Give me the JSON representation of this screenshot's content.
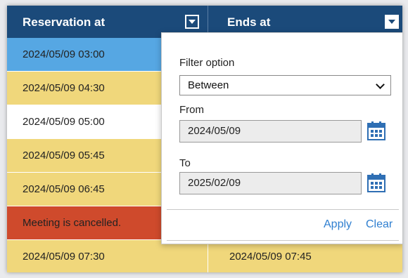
{
  "header": {
    "col1": "Reservation at",
    "col2": "Ends at"
  },
  "rows": [
    {
      "start": "2024/05/09 03:00",
      "end": ""
    },
    {
      "start": "2024/05/09 04:30",
      "end": ""
    },
    {
      "start": "2024/05/09 05:00",
      "end": ""
    },
    {
      "start": "2024/05/09 05:45",
      "end": ""
    },
    {
      "start": "2024/05/09 06:45",
      "end": ""
    },
    {
      "start": "Meeting is cancelled.",
      "end": ""
    },
    {
      "start": "2024/05/09 07:30",
      "end": "2024/05/09 07:45"
    }
  ],
  "filter": {
    "title": "Filter option",
    "option": "Between",
    "from_label": "From",
    "from_value": "2024/05/09",
    "to_label": "To",
    "to_value": "2025/02/09",
    "apply": "Apply",
    "clear": "Clear"
  },
  "colors": {
    "header": "#1b4a7a",
    "selected_row": "#56a7e3",
    "highlight_row": "#f0d77b",
    "cancelled_row": "#cf4a2c",
    "link": "#2f7fd0"
  },
  "icons": {
    "filter": "dropdown-filter-icon",
    "calendar": "calendar-icon",
    "select": "chevron-down-icon"
  }
}
